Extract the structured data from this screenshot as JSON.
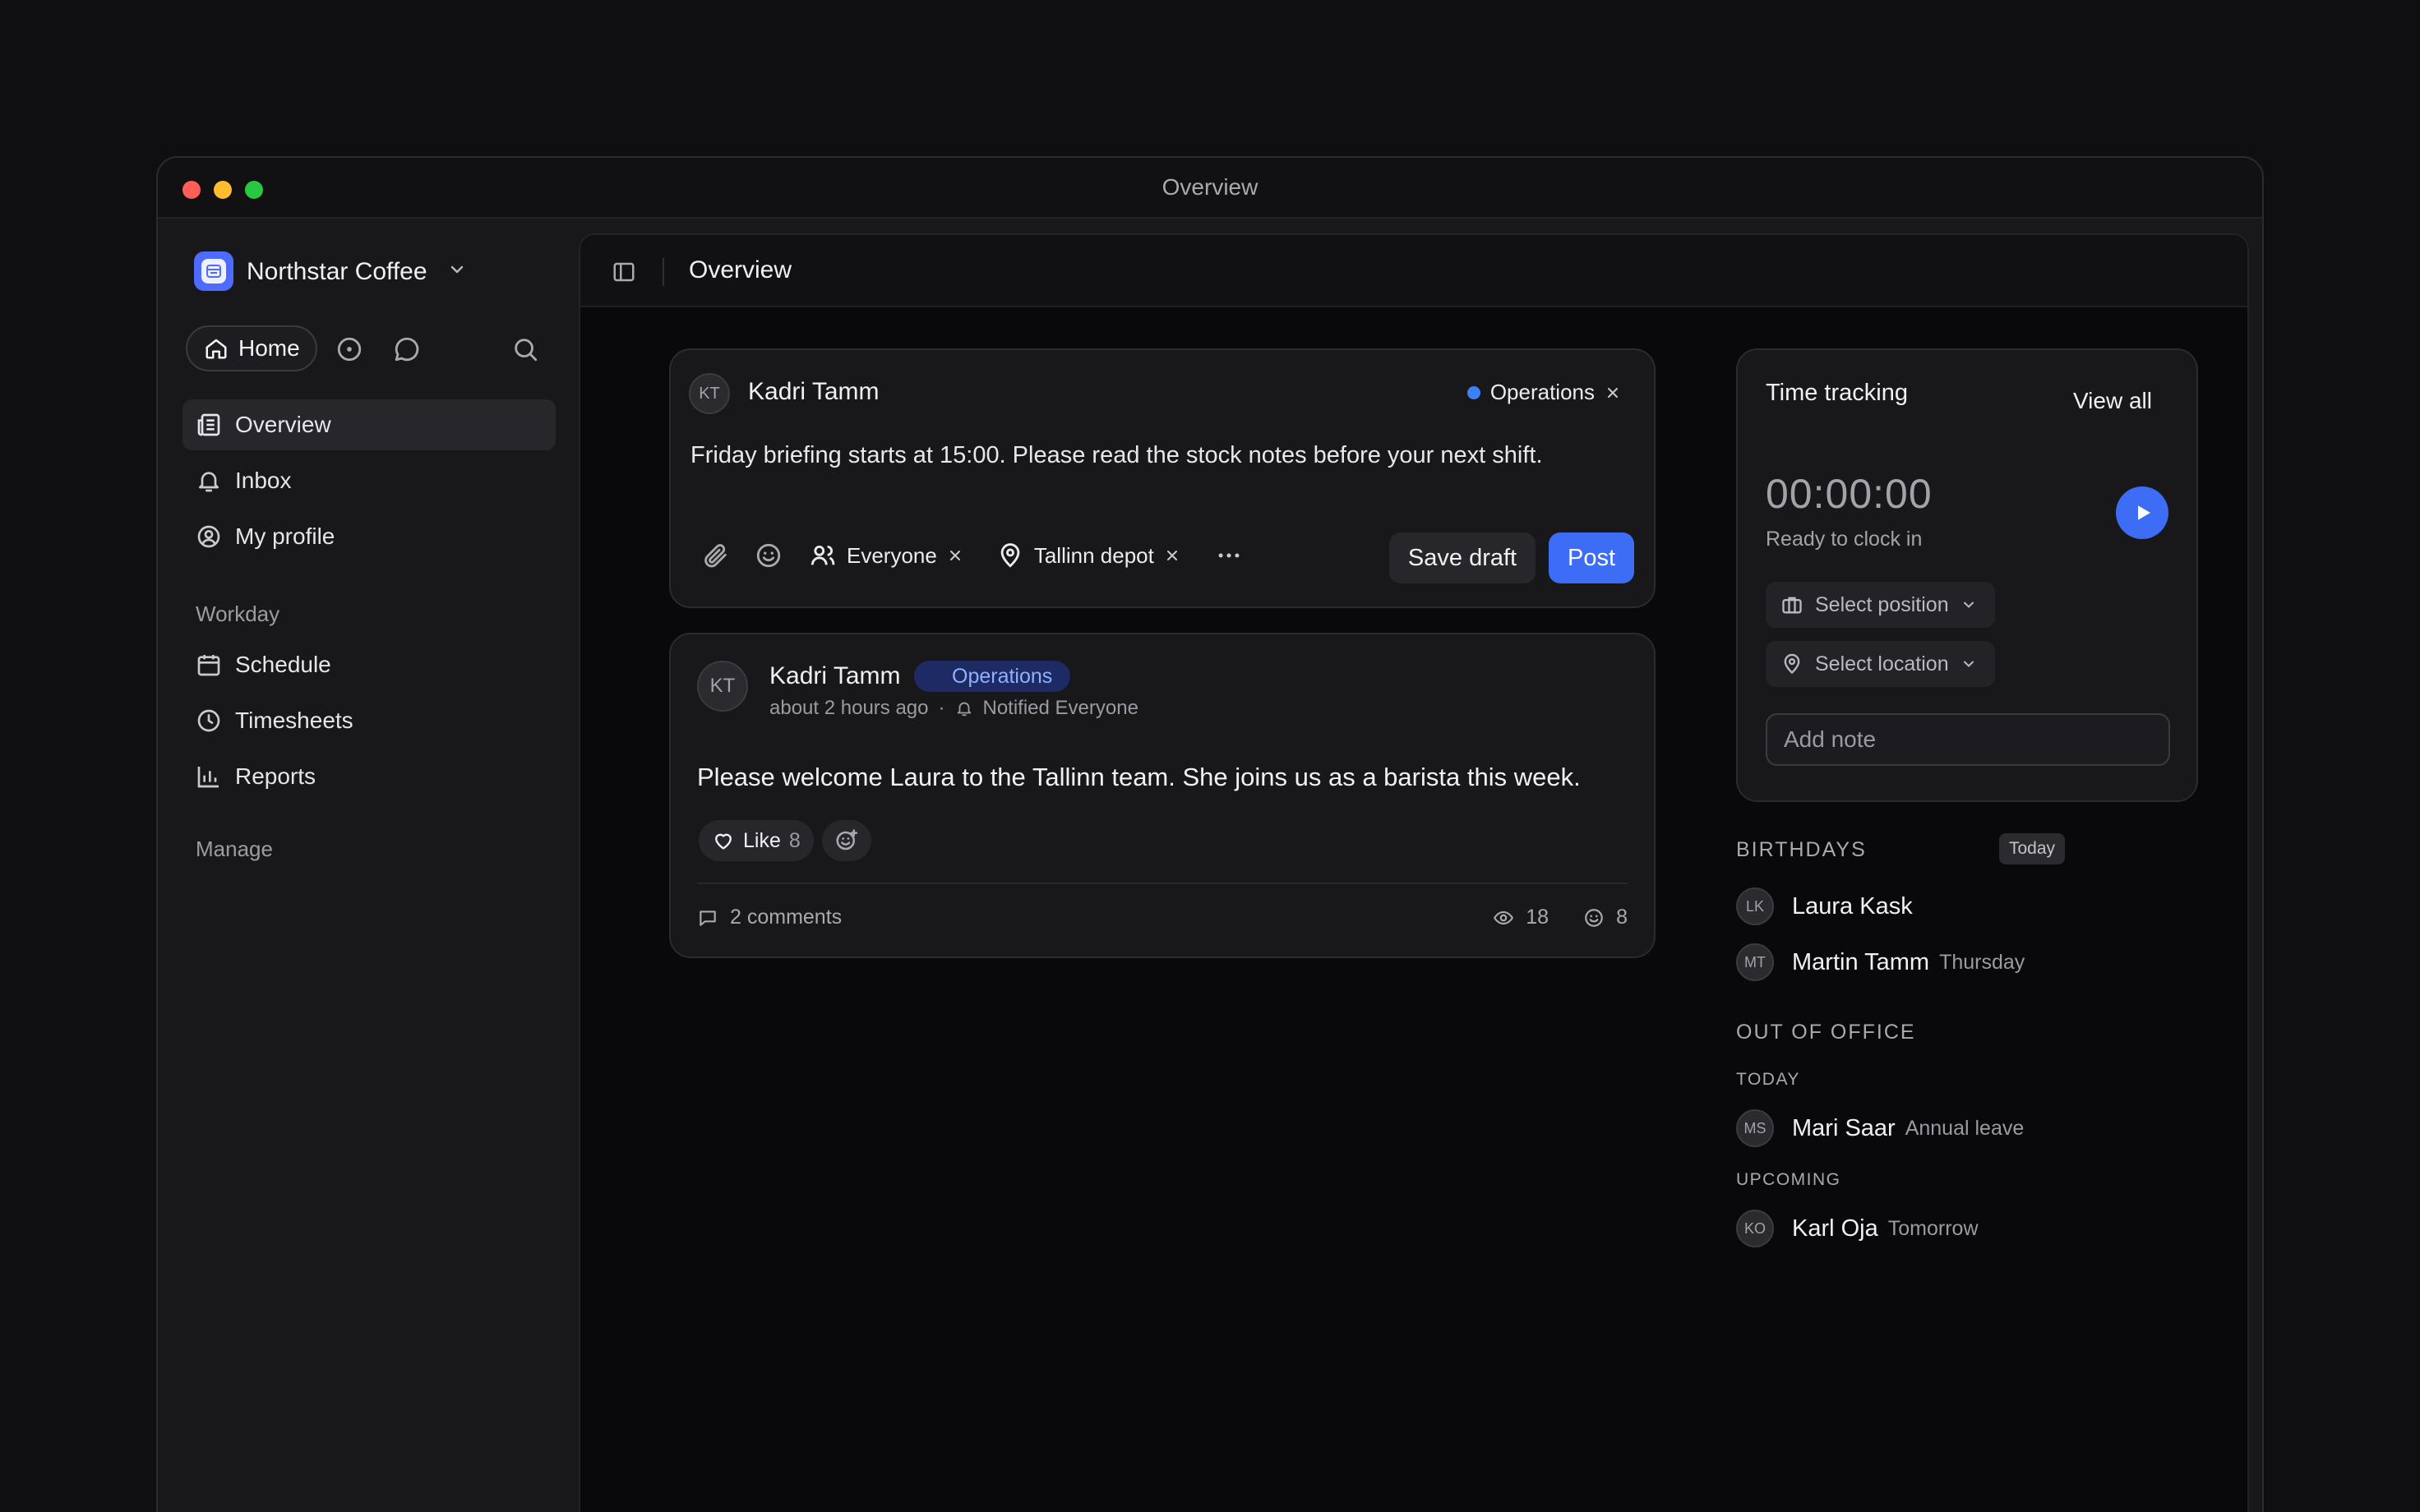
{
  "window": {
    "title": "Overview"
  },
  "sidebar": {
    "workspace": "Northstar Coffee",
    "home_label": "Home",
    "nav": [
      {
        "label": "Overview",
        "icon": "newspaper-icon",
        "active": true
      },
      {
        "label": "Inbox",
        "icon": "bell-icon"
      },
      {
        "label": "My profile",
        "icon": "user-circle-icon"
      }
    ],
    "workday_title": "Workday",
    "workday": [
      {
        "label": "Schedule",
        "icon": "calendar-icon"
      },
      {
        "label": "Timesheets",
        "icon": "clock-icon"
      },
      {
        "label": "Reports",
        "icon": "bar-chart-icon"
      }
    ],
    "manage_title": "Manage"
  },
  "header": {
    "title": "Overview"
  },
  "composer": {
    "avatar": "KT",
    "author": "Kadri Tamm",
    "tag": "Operations",
    "body": "Friday briefing starts at 15:00. Please read the stock notes before your next shift.",
    "audience": "Everyone",
    "location": "Tallinn depot",
    "save_draft": "Save draft",
    "post": "Post"
  },
  "post": {
    "avatar": "KT",
    "author": "Kadri Tamm",
    "tag": "Operations",
    "time": "about 2 hours ago",
    "notified": "Notified Everyone",
    "body": "Please welcome Laura to the Tallinn team. She joins us as a barista this week.",
    "like_label": "Like",
    "like_count": "8",
    "comments": "2 comments",
    "views": "18",
    "reactions": "8"
  },
  "time_tracking": {
    "title": "Time tracking",
    "view_all": "View all",
    "clock": "00:00:00",
    "status": "Ready to clock in",
    "select_position": "Select position",
    "select_location": "Select location",
    "note_placeholder": "Add note"
  },
  "birthdays": {
    "title": "BIRTHDAYS",
    "badge": "Today",
    "people": [
      {
        "initials": "LK",
        "name": "Laura Kask",
        "note": ""
      },
      {
        "initials": "MT",
        "name": "Martin Tamm",
        "note": "Thursday"
      }
    ]
  },
  "out_of_office": {
    "title": "OUT OF OFFICE",
    "today_title": "TODAY",
    "today": [
      {
        "initials": "MS",
        "name": "Mari Saar",
        "note": "Annual leave"
      }
    ],
    "upcoming_title": "UPCOMING",
    "upcoming": [
      {
        "initials": "KO",
        "name": "Karl Oja",
        "note": "Tomorrow"
      }
    ]
  },
  "colors": {
    "accent": "#3d6cf5",
    "tag_bg": "#1d2a63",
    "tag_text": "#8fb0ff"
  }
}
